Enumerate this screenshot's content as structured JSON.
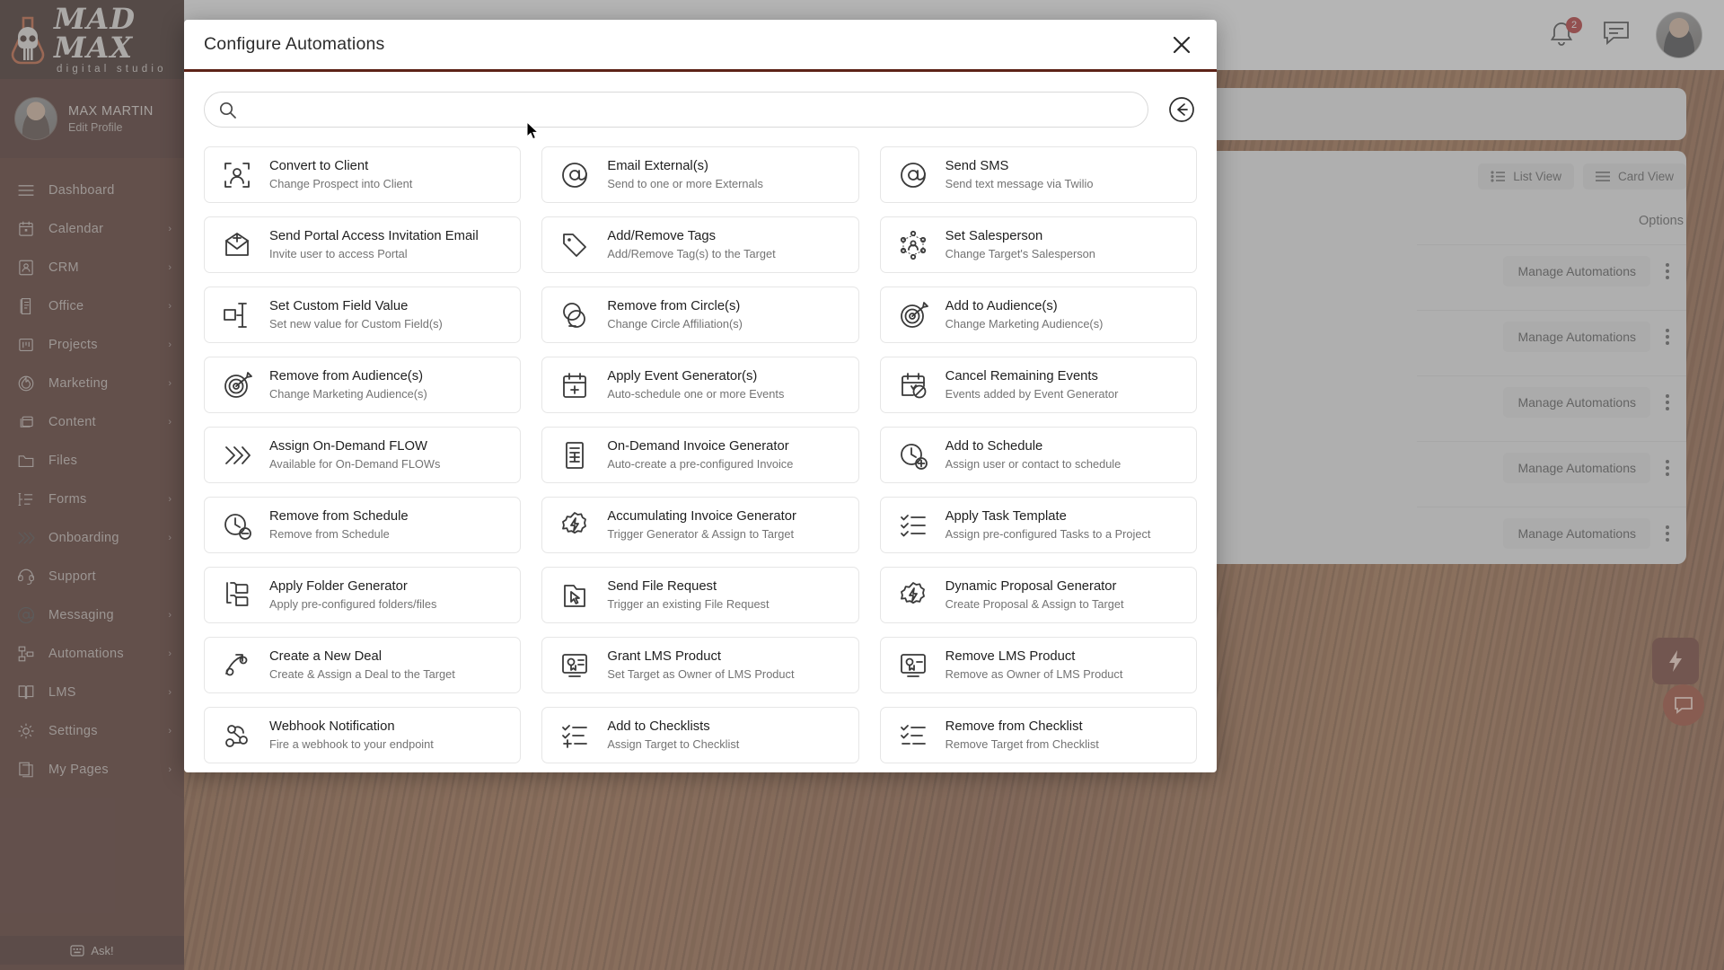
{
  "brand": {
    "logo_main": "MAD MAX",
    "logo_sub": "digital studio",
    "accent": "#5d2318",
    "sidebar_bg": "#4a1f16"
  },
  "sidebar": {
    "profile": {
      "name": "MAX MARTIN",
      "edit_link": "Edit Profile"
    },
    "items": [
      {
        "label": "Dashboard",
        "icon": "menu-icon",
        "chevron": ""
      },
      {
        "label": "Calendar",
        "icon": "calendar-icon",
        "chevron": "›"
      },
      {
        "label": "CRM",
        "icon": "contact-card-icon",
        "chevron": "›"
      },
      {
        "label": "Office",
        "icon": "document-icon",
        "chevron": "›"
      },
      {
        "label": "Projects",
        "icon": "kanban-icon",
        "chevron": "›"
      },
      {
        "label": "Marketing",
        "icon": "flame-icon",
        "chevron": "›"
      },
      {
        "label": "Content",
        "icon": "windows-icon",
        "chevron": "›"
      },
      {
        "label": "Files",
        "icon": "folder-icon",
        "chevron": ""
      },
      {
        "label": "Forms",
        "icon": "form-list-icon",
        "chevron": "›"
      },
      {
        "label": "Onboarding",
        "icon": "chevrons-icon",
        "chevron": "›"
      },
      {
        "label": "Support",
        "icon": "headset-icon",
        "chevron": ""
      },
      {
        "label": "Messaging",
        "icon": "at-icon",
        "chevron": "›"
      },
      {
        "label": "Automations",
        "icon": "sitemap-icon",
        "chevron": "›"
      },
      {
        "label": "LMS",
        "icon": "book-icon",
        "chevron": "›"
      },
      {
        "label": "Settings",
        "icon": "gear-icon",
        "chevron": "›"
      },
      {
        "label": "My Pages",
        "icon": "pages-icon",
        "chevron": "›"
      }
    ],
    "ask": {
      "label": "Ask!",
      "icon": "keyboard-icon"
    }
  },
  "header": {
    "notifications_badge": "2",
    "notification_icon": "bell-icon",
    "messages_icon": "chat-icon",
    "avatar": "user-avatar"
  },
  "background": {
    "view_toggles": [
      {
        "label": "List View",
        "icon": "list-icon"
      },
      {
        "label": "Card View",
        "icon": "card-icon"
      }
    ],
    "options_label": "Options",
    "rows": [
      {
        "button": "Manage Automations"
      },
      {
        "button": "Manage Automations"
      },
      {
        "button": "Manage Automations"
      },
      {
        "button": "Manage Automations"
      },
      {
        "button": "Manage Automations"
      }
    ],
    "fab_bolt_icon": "bolt-icon",
    "fab_chat_icon": "support-chat-icon"
  },
  "modal": {
    "title": "Configure Automations",
    "close_icon": "close-icon",
    "back_icon": "arrow-left-circle-icon",
    "search": {
      "value": "",
      "placeholder": "",
      "icon": "search-icon"
    },
    "cards": [
      {
        "title": "Convert to Client",
        "subtitle": "Change Prospect into Client",
        "icon": "convert-person-icon"
      },
      {
        "title": "Email External(s)",
        "subtitle": "Send to one or more Externals",
        "icon": "at-icon"
      },
      {
        "title": "Send SMS",
        "subtitle": "Send text message via Twilio",
        "icon": "at-icon"
      },
      {
        "title": "Send Portal Access Invitation Email",
        "subtitle": "Invite user to access Portal",
        "icon": "envelope-plus-icon"
      },
      {
        "title": "Add/Remove Tags",
        "subtitle": "Add/Remove Tag(s) to the Target",
        "icon": "tag-icon"
      },
      {
        "title": "Set Salesperson",
        "subtitle": "Change Target's Salesperson",
        "icon": "network-person-icon"
      },
      {
        "title": "Set Custom Field Value",
        "subtitle": "Set new value for Custom Field(s)",
        "icon": "custom-field-icon"
      },
      {
        "title": "Remove from Circle(s)",
        "subtitle": "Change Circle Affiliation(s)",
        "icon": "circles-minus-icon"
      },
      {
        "title": "Add to Audience(s)",
        "subtitle": "Change Marketing Audience(s)",
        "icon": "target-star-icon"
      },
      {
        "title": "Remove from Audience(s)",
        "subtitle": "Change Marketing Audience(s)",
        "icon": "target-star-icon"
      },
      {
        "title": "Apply Event Generator(s)",
        "subtitle": "Auto-schedule one or more Events",
        "icon": "calendar-plus-icon"
      },
      {
        "title": "Cancel Remaining Events",
        "subtitle": "Events added by Event Generator",
        "icon": "calendar-cancel-icon"
      },
      {
        "title": "Assign On-Demand FLOW",
        "subtitle": "Available for On-Demand FLOWs",
        "icon": "chevrons-icon"
      },
      {
        "title": "On-Demand Invoice Generator",
        "subtitle": "Auto-create a pre-configured Invoice",
        "icon": "invoice-icon"
      },
      {
        "title": "Add to Schedule",
        "subtitle": "Assign user or contact to schedule",
        "icon": "clock-plus-icon"
      },
      {
        "title": "Remove from Schedule",
        "subtitle": "Remove from Schedule",
        "icon": "clock-minus-icon"
      },
      {
        "title": "Accumulating Invoice Generator",
        "subtitle": "Trigger Generator & Assign to Target",
        "icon": "gear-bolt-icon"
      },
      {
        "title": "Apply Task Template",
        "subtitle": "Assign pre-configured Tasks to a Project",
        "icon": "checklist-icon"
      },
      {
        "title": "Apply Folder Generator",
        "subtitle": "Apply pre-configured folders/files",
        "icon": "folder-tree-icon"
      },
      {
        "title": "Send File Request",
        "subtitle": "Trigger an existing File Request",
        "icon": "folder-cursor-icon"
      },
      {
        "title": "Dynamic Proposal Generator",
        "subtitle": "Create Proposal & Assign to Target",
        "icon": "gear-bolt-icon"
      },
      {
        "title": "Create a New Deal",
        "subtitle": "Create & Assign a Deal to the Target",
        "icon": "deal-icon"
      },
      {
        "title": "Grant LMS Product",
        "subtitle": "Set Target as Owner of LMS Product",
        "icon": "lms-grant-icon"
      },
      {
        "title": "Remove LMS Product",
        "subtitle": "Remove as Owner of LMS Product",
        "icon": "lms-remove-icon"
      },
      {
        "title": "Webhook Notification",
        "subtitle": "Fire a webhook to your endpoint",
        "icon": "webhook-icon"
      },
      {
        "title": "Add to Checklists",
        "subtitle": "Assign Target to Checklist",
        "icon": "checklist-plus-icon"
      },
      {
        "title": "Remove from Checklist",
        "subtitle": "Remove Target from Checklist",
        "icon": "checklist-minus-icon"
      }
    ]
  }
}
